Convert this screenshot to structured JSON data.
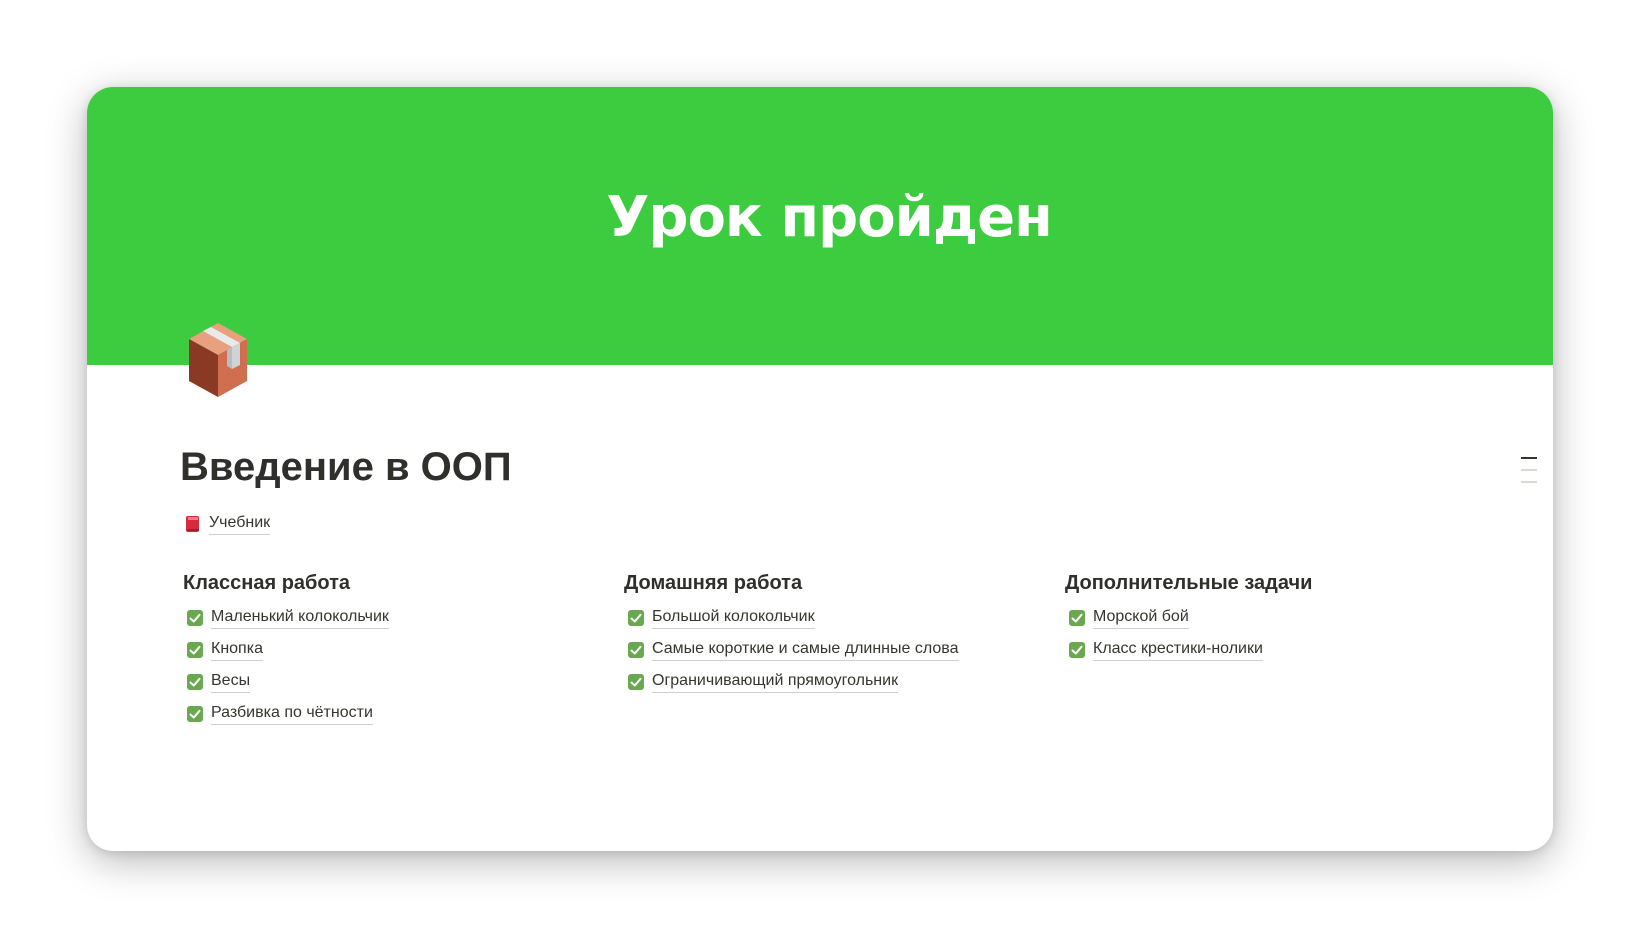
{
  "cover": {
    "text": "Урок пройден",
    "color": "#3dcb3f"
  },
  "page": {
    "icon": "package-box-icon",
    "title": "Введение в ООП",
    "link": {
      "icon": "red-book-icon",
      "label": "Учебник"
    }
  },
  "columns": [
    {
      "heading": "Классная работа",
      "items": [
        {
          "label": "Маленький колокольчик",
          "icon": "check-box-icon"
        },
        {
          "label": "Кнопка",
          "icon": "check-box-icon"
        },
        {
          "label": "Весы",
          "icon": "check-box-icon"
        },
        {
          "label": "Разбивка по чётности",
          "icon": "check-box-icon"
        }
      ]
    },
    {
      "heading": "Домашняя работа",
      "items": [
        {
          "label": "Большой колокольчик",
          "icon": "check-box-icon"
        },
        {
          "label": "Самые короткие и самые длинные слова",
          "icon": "check-box-icon"
        },
        {
          "label": "Ограничивающий прямоугольник",
          "icon": "check-box-icon"
        }
      ]
    },
    {
      "heading": "Дополнительные задачи",
      "items": [
        {
          "label": "Морской бой",
          "icon": "check-box-icon"
        },
        {
          "label": "Класс крестики-нолики",
          "icon": "check-box-icon"
        }
      ]
    }
  ],
  "colors": {
    "check_green": "#6aa84f",
    "book_red": "#d62b3c",
    "text": "#37352f"
  }
}
